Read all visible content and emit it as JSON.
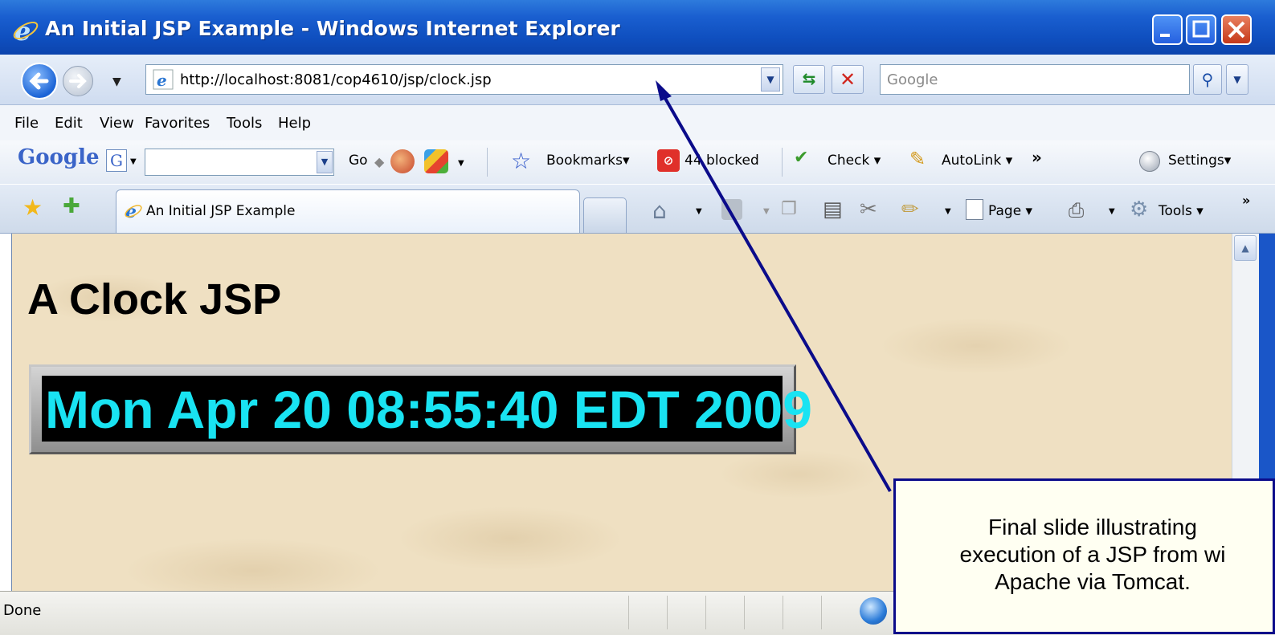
{
  "window": {
    "title": "An Initial JSP Example - Windows Internet Explorer",
    "controls": [
      "minimize",
      "maximize",
      "close"
    ]
  },
  "address_bar": {
    "url": "http://localhost:8081/cop4610/jsp/clock.jsp",
    "search_placeholder": "Google"
  },
  "menu": {
    "file": "File",
    "edit": "Edit",
    "view": "View",
    "favorites": "Favorites",
    "tools": "Tools",
    "help": "Help"
  },
  "google_toolbar": {
    "logo": "Google",
    "g_button": "G",
    "go": "Go",
    "bookmarks": "Bookmarks",
    "blocked": "44 blocked",
    "check": "Check",
    "autolink": "AutoLink",
    "more": "»",
    "settings": "Settings"
  },
  "tabs": {
    "active_tab_title": "An Initial JSP Example"
  },
  "command_bar": {
    "page": "Page",
    "tools": "Tools",
    "more": "»"
  },
  "content": {
    "heading": "A Clock JSP",
    "clock": "Mon Apr 20 08:55:40 EDT 2009"
  },
  "status_bar": {
    "text": "Done"
  },
  "callout": {
    "text": "Final slide illustrating\nexecution of a JSP from wi\nApache via Tomcat."
  },
  "colors": {
    "titlebar": "#0f4fbf",
    "clock_text": "#19e3f2",
    "clock_background": "#000000",
    "page_background": "#efe0c2",
    "callout_border": "#0b0b8a",
    "arrow": "#0b0b8a"
  },
  "icons": {
    "title": "ie-logo-icon",
    "back": "back-arrow-icon",
    "forward": "forward-arrow-icon",
    "refresh": "refresh-icon",
    "stop": "stop-icon",
    "search": "magnifier-icon",
    "favorites": "star-icon",
    "add_favorite": "add-star-icon",
    "home": "home-icon",
    "feeds": "feeds-icon",
    "print": "printer-icon",
    "tools": "gear-icon",
    "status": "globe-icon"
  }
}
